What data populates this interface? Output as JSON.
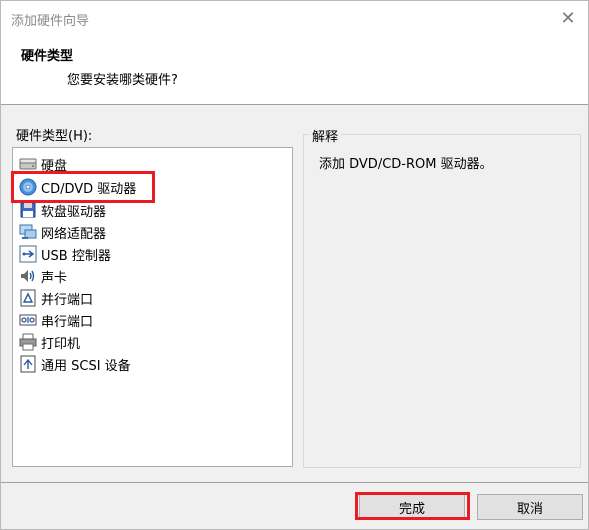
{
  "window": {
    "title": "添加硬件向导",
    "close_glyph": "✕"
  },
  "header": {
    "title": "硬件类型",
    "subtitle": "您要安装哪类硬件?"
  },
  "hardware_list": {
    "label": "硬件类型(H):",
    "selected_index": 1,
    "items": [
      {
        "label": "硬盘",
        "icon": "hard-disk-icon"
      },
      {
        "label": "CD/DVD 驱动器",
        "icon": "cd-dvd-icon"
      },
      {
        "label": "软盘驱动器",
        "icon": "floppy-icon"
      },
      {
        "label": "网络适配器",
        "icon": "network-adapter-icon"
      },
      {
        "label": "USB 控制器",
        "icon": "usb-icon"
      },
      {
        "label": "声卡",
        "icon": "sound-card-icon"
      },
      {
        "label": "并行端口",
        "icon": "parallel-port-icon"
      },
      {
        "label": "串行端口",
        "icon": "serial-port-icon"
      },
      {
        "label": "打印机",
        "icon": "printer-icon"
      },
      {
        "label": "通用 SCSI 设备",
        "icon": "scsi-device-icon"
      }
    ]
  },
  "explanation": {
    "legend": "解释",
    "text": "添加 DVD/CD-ROM 驱动器。"
  },
  "buttons": {
    "finish": "完成",
    "cancel": "取消"
  },
  "colors": {
    "highlight": "#ec1b23",
    "window_bg": "#f0f0f0"
  }
}
